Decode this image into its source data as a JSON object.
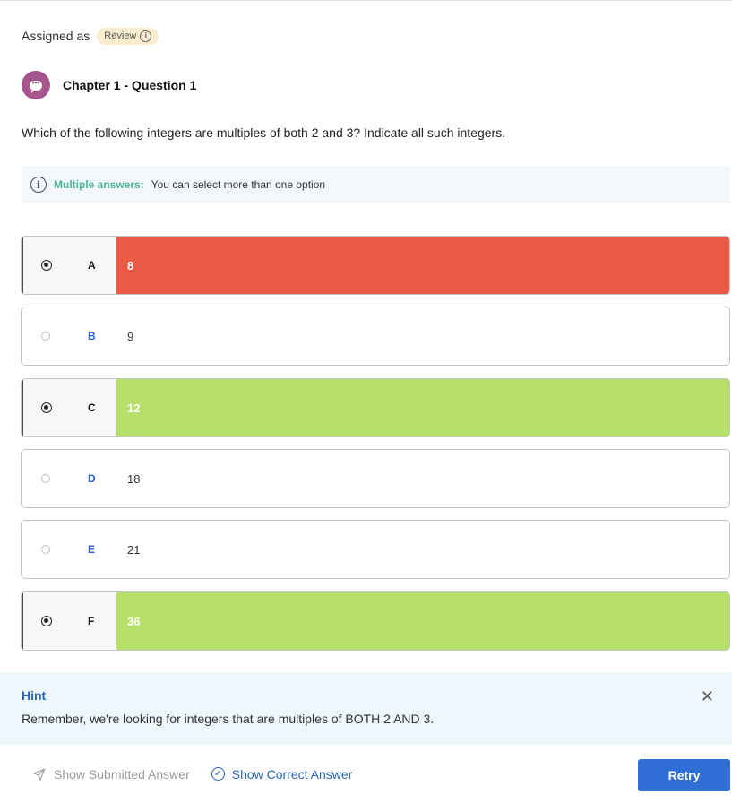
{
  "header": {
    "assigned_label": "Assigned as",
    "badge_label": "Review"
  },
  "question": {
    "title": "Chapter 1 - Question 1",
    "text": "Which of the following integers are multiples of both 2 and 3? Indicate all such integers."
  },
  "notice": {
    "label": "Multiple answers:",
    "text": "You can select more than one option"
  },
  "options": [
    {
      "letter": "A",
      "value": "8",
      "selected": true,
      "status": "wrong"
    },
    {
      "letter": "B",
      "value": "9",
      "selected": false,
      "status": "none"
    },
    {
      "letter": "C",
      "value": "12",
      "selected": true,
      "status": "correct"
    },
    {
      "letter": "D",
      "value": "18",
      "selected": false,
      "status": "none"
    },
    {
      "letter": "E",
      "value": "21",
      "selected": false,
      "status": "none"
    },
    {
      "letter": "F",
      "value": "36",
      "selected": true,
      "status": "correct"
    }
  ],
  "hint": {
    "title": "Hint",
    "text": "Remember, we're looking for integers that are multiples of BOTH 2 AND 3."
  },
  "footer": {
    "show_submitted": "Show Submitted Answer",
    "show_correct": "Show Correct Answer",
    "retry": "Retry"
  },
  "colors": {
    "wrong": "#e95a44",
    "correct": "#b6e06a",
    "accent": "#2f6fd6",
    "avatar": "#a6558f"
  },
  "icons": {
    "badge": "info-icon",
    "avatar": "chat-bubble-icon",
    "notice": "info-icon",
    "close": "close-icon",
    "submitted": "paper-plane-icon",
    "correct": "check-circle-icon"
  }
}
